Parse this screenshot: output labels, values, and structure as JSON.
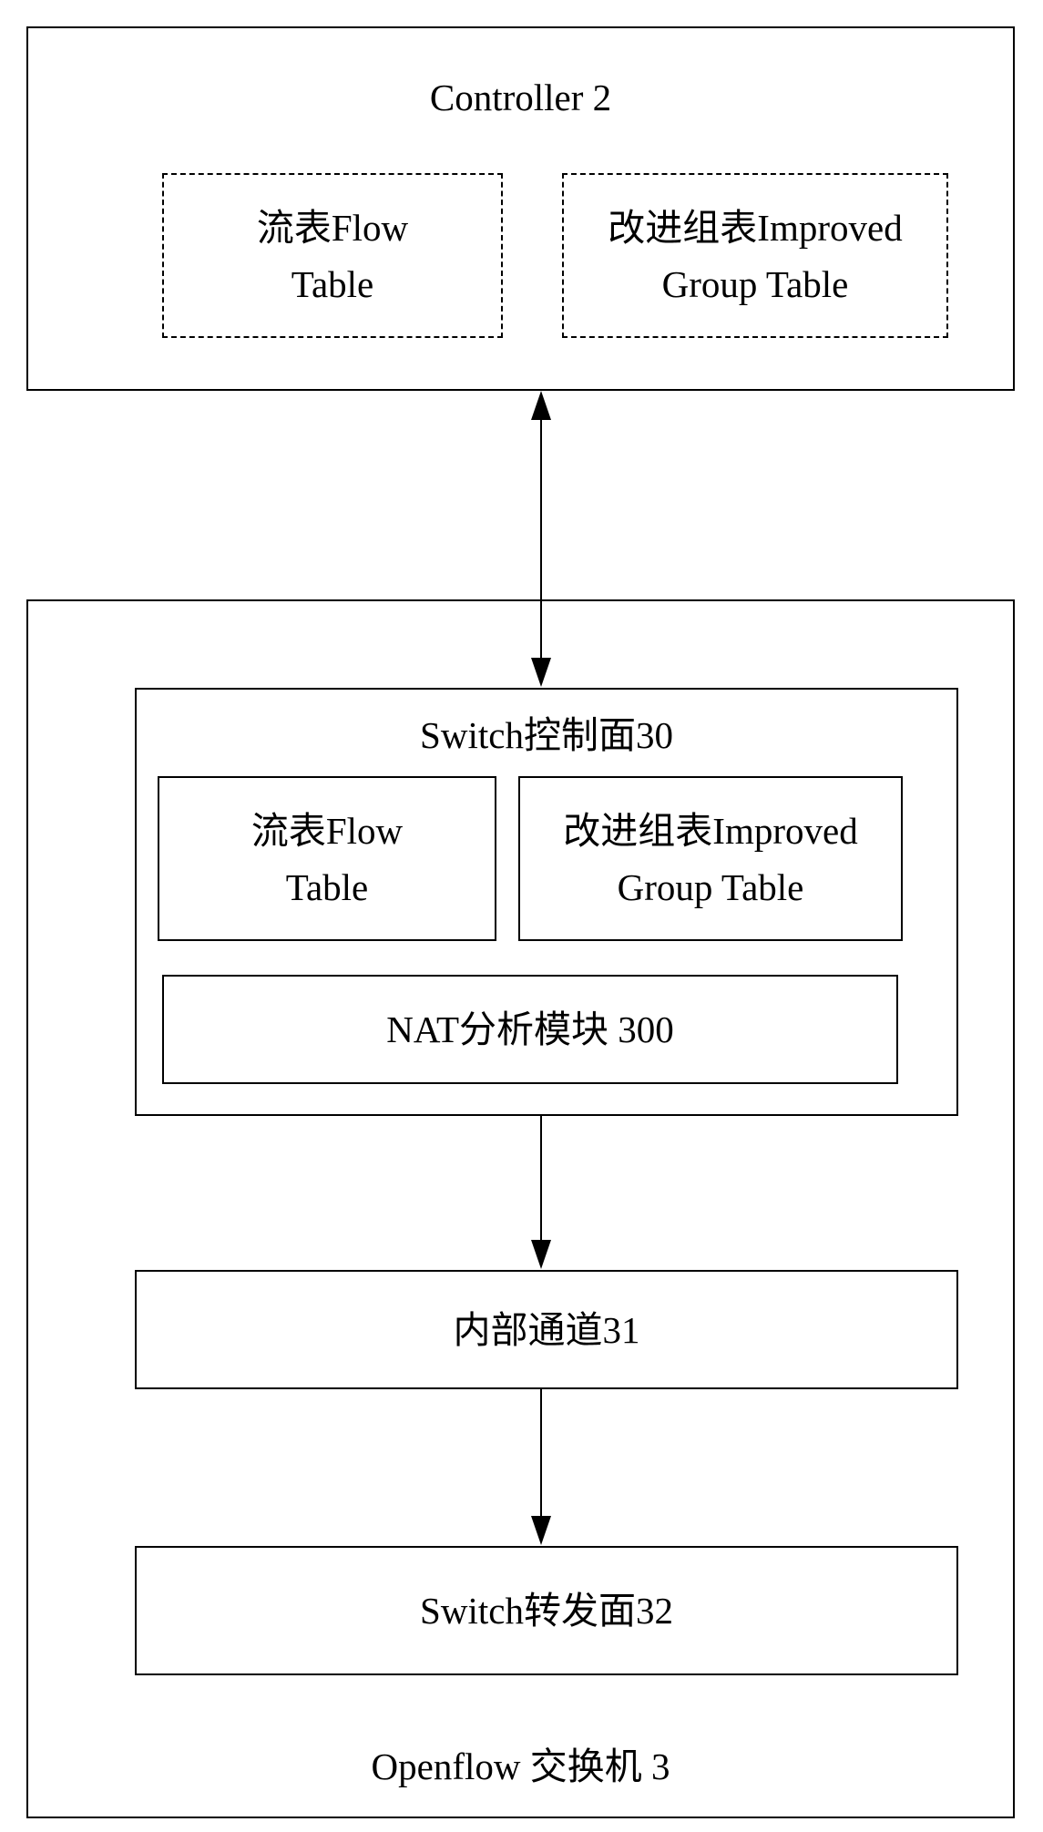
{
  "controller": {
    "title": "Controller 2",
    "flow_table": {
      "line1": "流表Flow",
      "line2": "Table"
    },
    "improved_group_table": {
      "line1": "改进组表Improved",
      "line2": "Group Table"
    }
  },
  "switch": {
    "title": "Openflow 交换机 3",
    "control_plane": {
      "title": "Switch控制面30",
      "flow_table": {
        "line1": "流表Flow",
        "line2": "Table"
      },
      "improved_group_table": {
        "line1": "改进组表Improved",
        "line2": "Group Table"
      },
      "nat_module": "NAT分析模块 300"
    },
    "internal_channel": "内部通道31",
    "forwarding_plane": "Switch转发面32"
  },
  "connections": [
    {
      "from": "controller",
      "to": "control_plane",
      "type": "bidirectional"
    },
    {
      "from": "control_plane",
      "to": "internal_channel",
      "type": "directed"
    },
    {
      "from": "internal_channel",
      "to": "forwarding_plane",
      "type": "directed"
    }
  ]
}
